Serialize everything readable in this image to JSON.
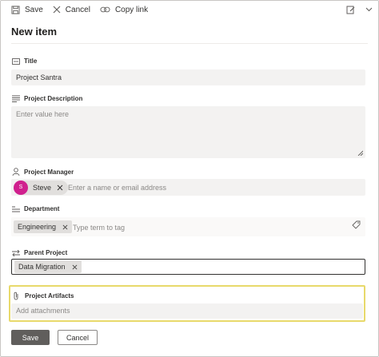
{
  "toolbar": {
    "save_label": "Save",
    "cancel_label": "Cancel",
    "copy_link_label": "Copy link"
  },
  "form": {
    "title": "New item",
    "fields": {
      "title": {
        "label": "Title",
        "value": "Project Santra"
      },
      "description": {
        "label": "Project Description",
        "placeholder": "Enter value here"
      },
      "manager": {
        "label": "Project Manager",
        "person": {
          "initial": "S",
          "name": "Steve"
        },
        "placeholder": "Enter a name or email address"
      },
      "department": {
        "label": "Department",
        "tag": "Engineering",
        "placeholder": "Type term to tag"
      },
      "parent": {
        "label": "Parent Project",
        "tag": "Data Migration"
      },
      "artifacts": {
        "label": "Project Artifacts",
        "placeholder": "Add attachments"
      }
    }
  },
  "actions": {
    "save_label": "Save",
    "cancel_label": "Cancel"
  },
  "colors": {
    "accent": "#d0208e",
    "highlight_border": "#e8d96b",
    "primary_button": "#605e5c"
  },
  "icons": {
    "save": "save-icon",
    "cancel": "close-icon",
    "copy_link": "link-icon",
    "edit_form": "edit-form-icon",
    "chevron": "chevron-down-icon"
  }
}
